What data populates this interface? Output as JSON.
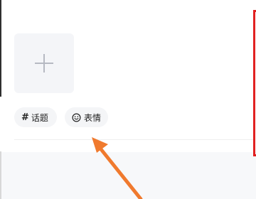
{
  "upload": {
    "icon": "plus-icon"
  },
  "chips": [
    {
      "icon": "hash-icon",
      "icon_glyph": "#",
      "label": "话题"
    },
    {
      "icon": "smile-icon",
      "label": "表情"
    }
  ],
  "annotation": {
    "arrow_color": "#f07a2e",
    "box_color": "#e12020"
  }
}
